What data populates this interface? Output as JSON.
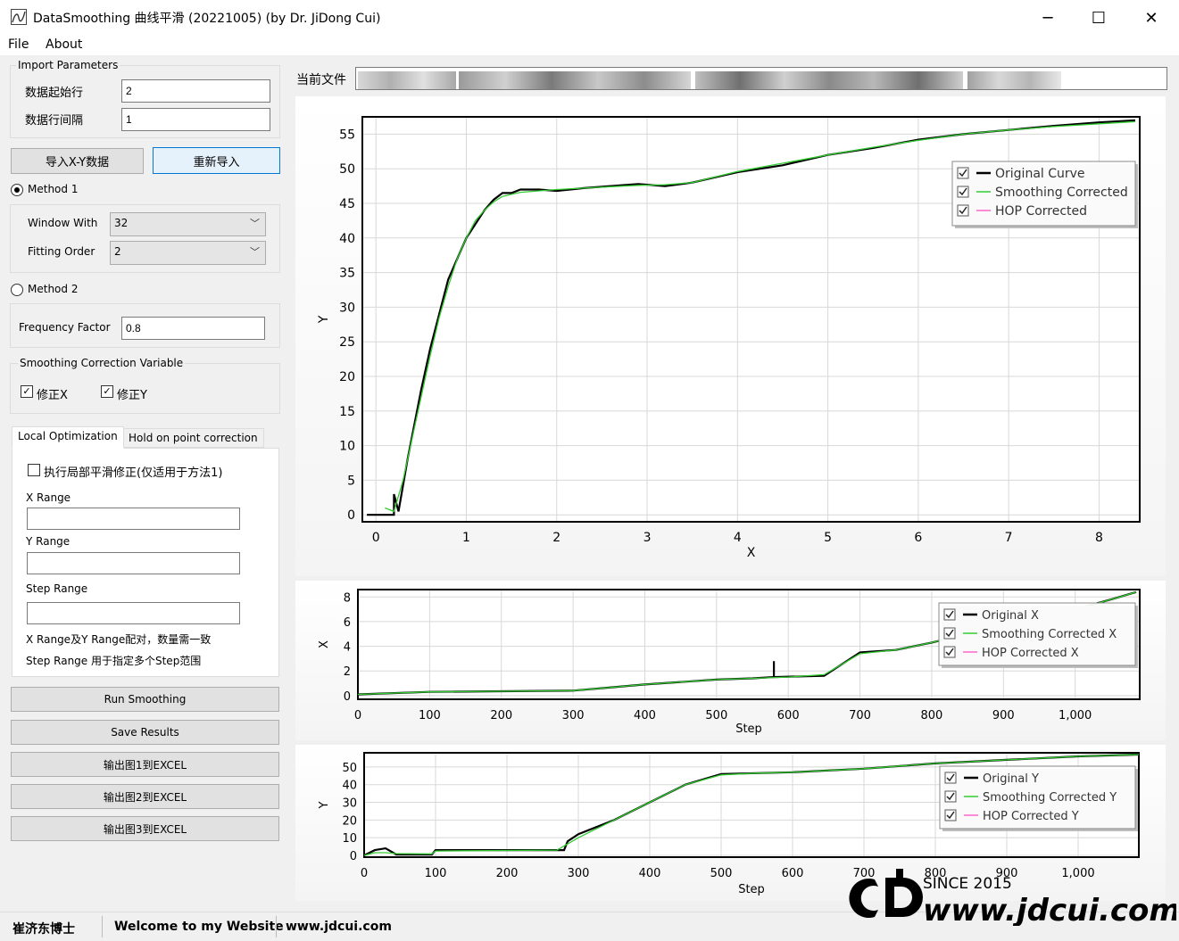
{
  "window": {
    "title": "DataSmoothing 曲线平滑 (20221005) (by Dr. JiDong Cui)",
    "minimize": "─",
    "maximize": "☐",
    "close": "✕"
  },
  "menu": {
    "file": "File",
    "about": "About"
  },
  "import": {
    "group_title": "Import Parameters",
    "start_row_label": "数据起始行",
    "start_row_value": "2",
    "row_interval_label": "数据行间隔",
    "row_interval_value": "1",
    "import_button": "导入X-Y数据",
    "reimport_button": "重新导入"
  },
  "method1": {
    "label": "Method 1",
    "window_label": "Window With",
    "window_value": "32",
    "order_label": "Fitting Order",
    "order_value": "2"
  },
  "method2": {
    "label": "Method 2",
    "freq_label": "Frequency Factor",
    "freq_value": "0.8"
  },
  "correction": {
    "group_title": "Smoothing Correction Variable",
    "fix_x": "修正X",
    "fix_y": "修正Y"
  },
  "tabs": {
    "local": "Local Optimization",
    "hold": "Hold on point correction",
    "local_check": "执行局部平滑修正(仅适用于方法1)",
    "x_range": "X Range",
    "y_range": "Y Range",
    "step_range": "Step Range",
    "note1": "X Range及Y Range配对，数量需一致",
    "note2": "Step Range 用于指定多个Step范围"
  },
  "actions": {
    "run": "Run Smoothing",
    "save": "Save Results",
    "export1": "输出图1到EXCEL",
    "export2": "输出图2到EXCEL",
    "export3": "输出图3到EXCEL"
  },
  "current_file_label": "当前文件",
  "status": {
    "author": "崔济东博士",
    "welcome": "Welcome to my Website",
    "site": "www.jdcui.com"
  },
  "watermark": {
    "since": "SINCE 2015",
    "url": "www.jdcui.com"
  },
  "colors": {
    "original": "#000000",
    "smooth": "#33cc33",
    "hop": "#ff66cc",
    "accent": "#0078d7"
  },
  "chart_data": [
    {
      "type": "line",
      "xlabel": "X",
      "ylabel": "Y",
      "xlim": [
        -0.15,
        8.45
      ],
      "ylim": [
        -1,
        57.5
      ],
      "xticks": [
        "0",
        "1",
        "2",
        "3",
        "4",
        "5",
        "6",
        "7",
        "8"
      ],
      "yticks": [
        "0",
        "5",
        "10",
        "15",
        "20",
        "25",
        "30",
        "35",
        "40",
        "45",
        "50",
        "55"
      ],
      "legend": [
        "Original Curve",
        "Smoothing Corrected",
        "HOP Corrected"
      ],
      "legend_position": "top-right",
      "series": [
        {
          "name": "Original Curve",
          "x": [
            -0.1,
            0.2,
            0.2,
            0.25,
            0.35,
            0.5,
            0.6,
            0.7,
            0.8,
            0.9,
            1.0,
            1.1,
            1.2,
            1.3,
            1.4,
            1.5,
            1.6,
            1.8,
            2.0,
            2.3,
            2.6,
            2.9,
            3.2,
            3.5,
            4.0,
            4.5,
            5.0,
            5.5,
            6.0,
            6.5,
            7.0,
            7.5,
            8.0,
            8.4
          ],
          "y": [
            0,
            0,
            3,
            0.5,
            8,
            18,
            24,
            29,
            34,
            37,
            40,
            42,
            44,
            45.5,
            46.5,
            46.5,
            47,
            47,
            46.8,
            47.2,
            47.5,
            47.8,
            47.5,
            48,
            49.5,
            50.5,
            52,
            53,
            54.2,
            55,
            55.6,
            56.2,
            56.7,
            57
          ]
        },
        {
          "name": "Smoothing Corrected",
          "x": [
            0.1,
            0.2,
            0.3,
            0.4,
            0.5,
            0.6,
            0.7,
            0.8,
            0.9,
            1.0,
            1.1,
            1.2,
            1.3,
            1.4,
            1.5,
            1.6,
            1.8,
            2.0,
            2.3,
            2.6,
            2.9,
            3.2,
            3.5,
            4.0,
            4.5,
            5.0,
            5.5,
            6.0,
            6.5,
            7.0,
            7.5,
            8.0,
            8.4
          ],
          "y": [
            1,
            0.5,
            5,
            11,
            17,
            23,
            28.5,
            33,
            37,
            40,
            42.5,
            44,
            45.2,
            46,
            46.3,
            46.6,
            46.8,
            47,
            47.2,
            47.4,
            47.6,
            47.7,
            48,
            49.6,
            50.8,
            52,
            53.1,
            54.1,
            55,
            55.6,
            56.1,
            56.5,
            56.8
          ]
        },
        {
          "name": "HOP Corrected",
          "x": [],
          "y": []
        }
      ]
    },
    {
      "type": "line",
      "xlabel": "Step",
      "ylabel": "X",
      "xlim": [
        0,
        1090
      ],
      "ylim": [
        -0.3,
        8.6
      ],
      "xticks": [
        "0",
        "100",
        "200",
        "300",
        "400",
        "500",
        "600",
        "700",
        "800",
        "900",
        "1,000"
      ],
      "yticks": [
        "0",
        "2",
        "4",
        "6",
        "8"
      ],
      "legend": [
        "Original X",
        "Smoothing Corrected X",
        "HOP Corrected X"
      ],
      "legend_position": "top-right",
      "series": [
        {
          "name": "Original X",
          "x": [
            0,
            100,
            200,
            300,
            350,
            400,
            500,
            550,
            580,
            580,
            580,
            650,
            700,
            750,
            800,
            850,
            900,
            950,
            1000,
            1050,
            1085
          ],
          "y": [
            0.1,
            0.3,
            0.35,
            0.4,
            0.65,
            0.9,
            1.3,
            1.4,
            1.5,
            2.8,
            1.5,
            1.6,
            3.5,
            3.7,
            4.3,
            5.0,
            5.7,
            6.4,
            7.0,
            7.8,
            8.4
          ]
        },
        {
          "name": "Smoothing Corrected X",
          "x": [
            0,
            100,
            200,
            300,
            350,
            400,
            500,
            550,
            600,
            650,
            700,
            750,
            800,
            850,
            900,
            950,
            1000,
            1050,
            1085
          ],
          "y": [
            0.1,
            0.3,
            0.35,
            0.4,
            0.65,
            0.9,
            1.3,
            1.4,
            1.5,
            1.7,
            3.4,
            3.7,
            4.3,
            5.0,
            5.7,
            6.4,
            7.0,
            7.8,
            8.4
          ]
        },
        {
          "name": "HOP Corrected X",
          "x": [],
          "y": []
        }
      ]
    },
    {
      "type": "line",
      "xlabel": "Step",
      "ylabel": "Y",
      "xlim": [
        0,
        1085
      ],
      "ylim": [
        -1,
        58
      ],
      "xticks": [
        "0",
        "100",
        "200",
        "300",
        "400",
        "500",
        "600",
        "700",
        "800",
        "900",
        "1,000"
      ],
      "yticks": [
        "0",
        "10",
        "20",
        "30",
        "40",
        "50"
      ],
      "legend": [
        "Original Y",
        "Smoothing Corrected Y",
        "HOP Corrected Y"
      ],
      "legend_position": "top-right",
      "series": [
        {
          "name": "Original Y",
          "x": [
            0,
            15,
            30,
            45,
            95,
            100,
            280,
            285,
            300,
            350,
            400,
            450,
            500,
            550,
            600,
            700,
            800,
            900,
            1000,
            1085
          ],
          "y": [
            0,
            3,
            4,
            0.5,
            0.5,
            3,
            3,
            8,
            12,
            20,
            30,
            40,
            46,
            46.5,
            47,
            49,
            52,
            54,
            56,
            57
          ]
        },
        {
          "name": "Smoothing Corrected Y",
          "x": [
            0,
            15,
            30,
            45,
            95,
            100,
            270,
            300,
            350,
            400,
            450,
            500,
            550,
            600,
            700,
            800,
            900,
            1000,
            1085
          ],
          "y": [
            0,
            1.5,
            1.5,
            1,
            0.8,
            2.5,
            3,
            10,
            20,
            30,
            40,
            45.5,
            46.5,
            47,
            49,
            52,
            54,
            56,
            57
          ]
        },
        {
          "name": "HOP Corrected Y",
          "x": [],
          "y": []
        }
      ]
    }
  ]
}
